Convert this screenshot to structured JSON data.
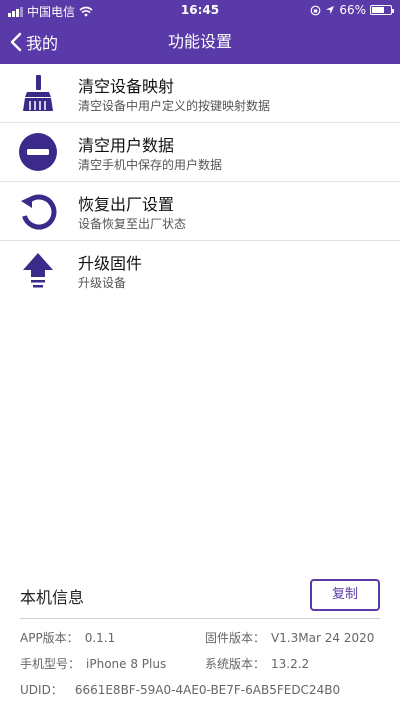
{
  "status": {
    "carrier": "中国电信",
    "time": "16:45",
    "battery_percent": "66%",
    "battery_level": 0.66
  },
  "nav": {
    "back_label": "我的",
    "title": "功能设置"
  },
  "settings": [
    {
      "title": "清空设备映射",
      "subtitle": "清空设备中用户定义的按键映射数据",
      "icon": "broom-icon"
    },
    {
      "title": "清空用户数据",
      "subtitle": "清空手机中保存的用户数据",
      "icon": "minus-circle-icon"
    },
    {
      "title": "恢复出厂设置",
      "subtitle": "设备恢复至出厂状态",
      "icon": "restore-icon"
    },
    {
      "title": "升级固件",
      "subtitle": "升级设备",
      "icon": "upgrade-arrow-icon"
    }
  ],
  "device_info": {
    "heading": "本机信息",
    "copy_label": "复制",
    "app_version_label": "APP版本：",
    "app_version": "0.1.1",
    "firmware_version_label": "固件版本：",
    "firmware_version": "V1.3Mar 24 2020",
    "phone_model_label": "手机型号：",
    "phone_model": "iPhone 8 Plus",
    "system_version_label": "系统版本：",
    "system_version": "13.2.2",
    "udid_label": "UDID：",
    "udid": "6661E8BF-59A0-4AE0-BE7F-6AB5FEDC24B0"
  },
  "colors": {
    "accent": "#5a3aa8",
    "icon": "#3b2a8a"
  }
}
